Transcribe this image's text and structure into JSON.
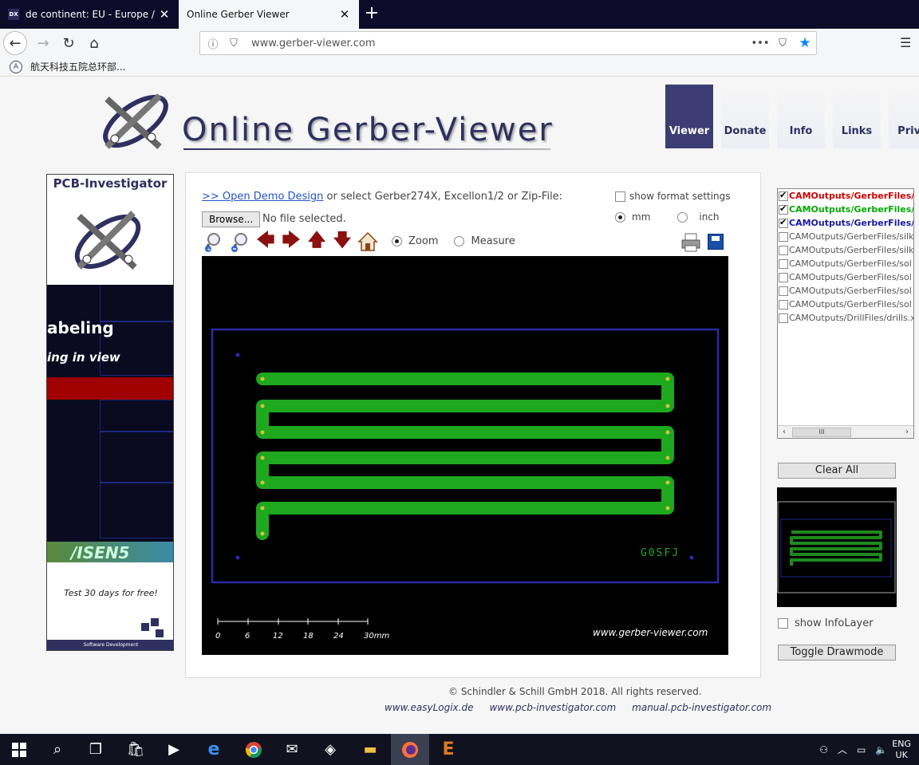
{
  "browser": {
    "tabs": [
      {
        "favicon": "DX",
        "title": "de continent: EU - Europe / bar",
        "active": false
      },
      {
        "title": "Online Gerber Viewer",
        "active": true
      }
    ],
    "url": "www.gerber-viewer.com",
    "bookmark": "航天科技五院总环部..."
  },
  "site": {
    "logo_title": "Online Gerber-Viewer",
    "nav": [
      "Viewer",
      "Donate",
      "Info",
      "Links",
      "Priva"
    ]
  },
  "ad": {
    "title": "PCB-Investigator",
    "label1": "abeling",
    "label2": "ing in view",
    "isens": "/ISEN5",
    "trial": "Test 30 days for free!",
    "footer": "Software Development"
  },
  "main": {
    "demo_link": ">> Open Demo Design",
    "demo_rest": " or select Gerber274X, Excellon1/2 or Zip-File:",
    "browse": "Browse...",
    "file_status": "No file selected.",
    "format_settings": "show format settings",
    "unit_mm": "mm",
    "unit_inch": "inch",
    "mode_zoom": "Zoom",
    "mode_measure": "Measure"
  },
  "viewer": {
    "board_text": "G0SFJ",
    "watermark": "www.gerber-viewer.com",
    "scale_labels": [
      "0",
      "6",
      "12",
      "18",
      "24",
      "30mm"
    ]
  },
  "layers": [
    {
      "name": "CAMOutputs/GerberFiles/c",
      "checked": true,
      "color": "#cc0000"
    },
    {
      "name": "CAMOutputs/GerberFiles/c",
      "checked": true,
      "color": "#00aa00"
    },
    {
      "name": "CAMOutputs/GerberFiles/p",
      "checked": true,
      "color": "#1a1aa0"
    },
    {
      "name": "CAMOutputs/GerberFiles/silk",
      "checked": false,
      "color": "#555555"
    },
    {
      "name": "CAMOutputs/GerberFiles/silk",
      "checked": false,
      "color": "#555555"
    },
    {
      "name": "CAMOutputs/GerberFiles/sol",
      "checked": false,
      "color": "#555555"
    },
    {
      "name": "CAMOutputs/GerberFiles/sol",
      "checked": false,
      "color": "#555555"
    },
    {
      "name": "CAMOutputs/GerberFiles/sol",
      "checked": false,
      "color": "#555555"
    },
    {
      "name": "CAMOutputs/GerberFiles/sol",
      "checked": false,
      "color": "#555555"
    },
    {
      "name": "CAMOutputs/DrillFiles/drills.x",
      "checked": false,
      "color": "#555555"
    }
  ],
  "side": {
    "clear_all": "Clear All",
    "show_infolayer": "show InfoLayer",
    "toggle_drawmode": "Toggle Drawmode",
    "scroll_thumb": "III"
  },
  "footer": {
    "copyright": "© Schindler & Schill GmbH 2018. All rights reserved.",
    "links": [
      "www.easyLogix.de",
      "www.pcb-investigator.com",
      "manual.pcb-investigator.com"
    ]
  },
  "taskbar": {
    "lang_top": "ENG",
    "lang_bottom": "UK"
  }
}
